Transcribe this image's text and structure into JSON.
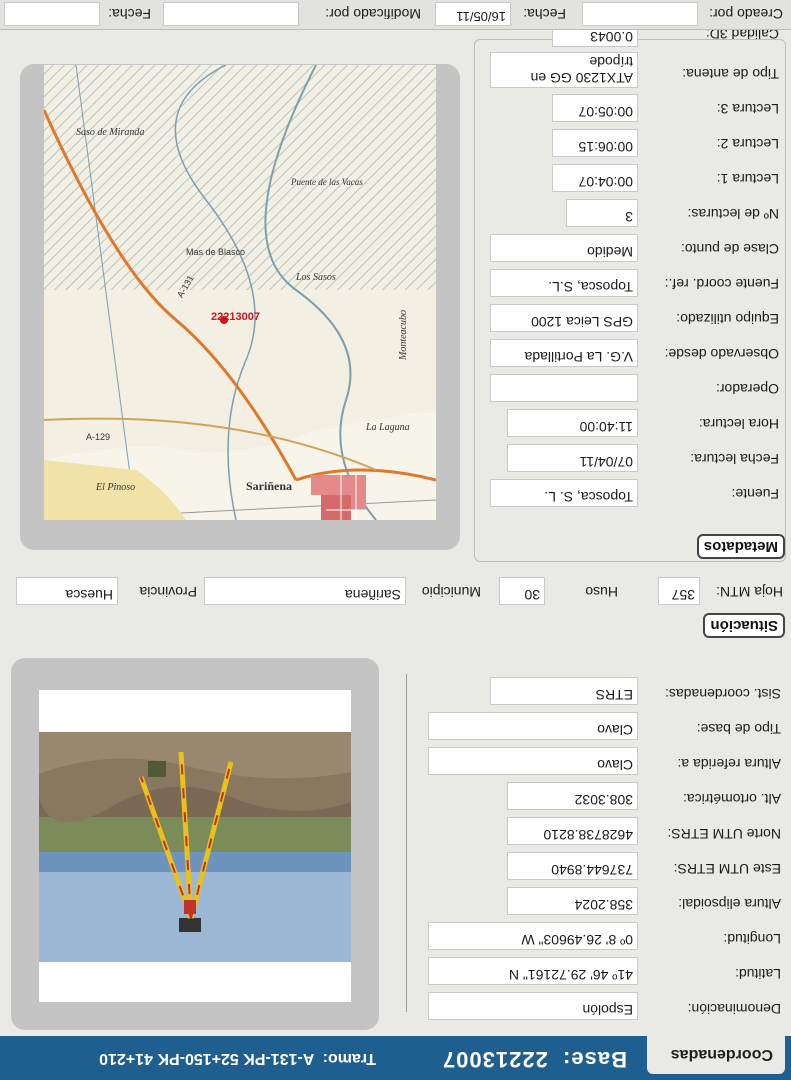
{
  "header": {
    "tab_label": "Coordenadas",
    "base_label": "Base:",
    "base_value": "22213007",
    "tramo_label": "Tramo:",
    "tramo_value": "A-131-PK 52+150-PK 41+210"
  },
  "coordinates": {
    "rows": [
      {
        "label": "Denominación:",
        "value": "Espolón"
      },
      {
        "label": "Latitud:",
        "value": "41º 46' 29.72161\" N"
      },
      {
        "label": "Longitud:",
        "value": "0º  8' 26.49603\" W"
      },
      {
        "label": "Altura elipsoidal:",
        "value": "358.2024"
      },
      {
        "label": "Este UTM ETRS:",
        "value": "737644.8940"
      },
      {
        "label": "Norte UTM ETRS:",
        "value": "4628738.8210"
      },
      {
        "label": "Alt. ortométrica:",
        "value": "308.3032"
      },
      {
        "label": "Altura referida a:",
        "value": "Clavo"
      },
      {
        "label": "Tipo de base:",
        "value": "Clavo"
      },
      {
        "label": "Sist. coordenadas:",
        "value": "ETRS"
      }
    ]
  },
  "situacion": {
    "title": "Situación",
    "hoja_label": "Hoja MTN:",
    "hoja_value": "357",
    "huso_label": "Huso",
    "huso_value": "30",
    "municipio_label": "Municipio",
    "municipio_value": "Sariñena",
    "provincia_label": "Provincia",
    "provincia_value": "Huesca"
  },
  "metadatos": {
    "title": "Metadatos",
    "rows": [
      {
        "label": "Fuente:",
        "value": "Toposca, S. L."
      },
      {
        "label": "Fecha lectura:",
        "value": "07/04/11"
      },
      {
        "label": "Hora lectura:",
        "value": "11:40:00"
      },
      {
        "label": "Operador:",
        "value": ""
      },
      {
        "label": "Observado desde:",
        "value": "V.G. La Portillada"
      },
      {
        "label": "Equipo utilizado:",
        "value": "GPS Leica 1200"
      },
      {
        "label": "Fuente coord. ref.:",
        "value": "Toposca, S.L."
      },
      {
        "label": "Clase de punto:",
        "value": "Medido"
      },
      {
        "label": "Nº de lecturas:",
        "value": "3"
      },
      {
        "label": "Lectura 1:",
        "value": "00:04:07"
      },
      {
        "label": "Lectura 2:",
        "value": "00:06:15"
      },
      {
        "label": "Lectura 3:",
        "value": "00:05:07"
      },
      {
        "label": "Tipo de antena:",
        "value": "ATX1230 GG en trípode"
      },
      {
        "label": "Calidad 3D:",
        "value": "0.0043"
      }
    ]
  },
  "map": {
    "point_label": "22213007",
    "place_labels": [
      "Sariñena",
      "El Pinoso",
      "La Laguna",
      "Los Sasos",
      "Saso de Miranda",
      "Mas de Blasco",
      "Monteacubo",
      "Puente de las Vacas"
    ],
    "road_labels": [
      "A-129",
      "A-131"
    ]
  },
  "footer": {
    "creado_label": "Creado por:",
    "creado_value": "",
    "fecha1_label": "Fecha:",
    "fecha1_value": "16/05/11",
    "modificado_label": "Modificado por:",
    "modificado_value": "",
    "fecha2_label": "Fecha:",
    "fecha2_value": ""
  },
  "colors": {
    "header_bg": "#1f5f8f",
    "panel_bg": "#e9e9e6",
    "map_point": "#d0121b"
  }
}
